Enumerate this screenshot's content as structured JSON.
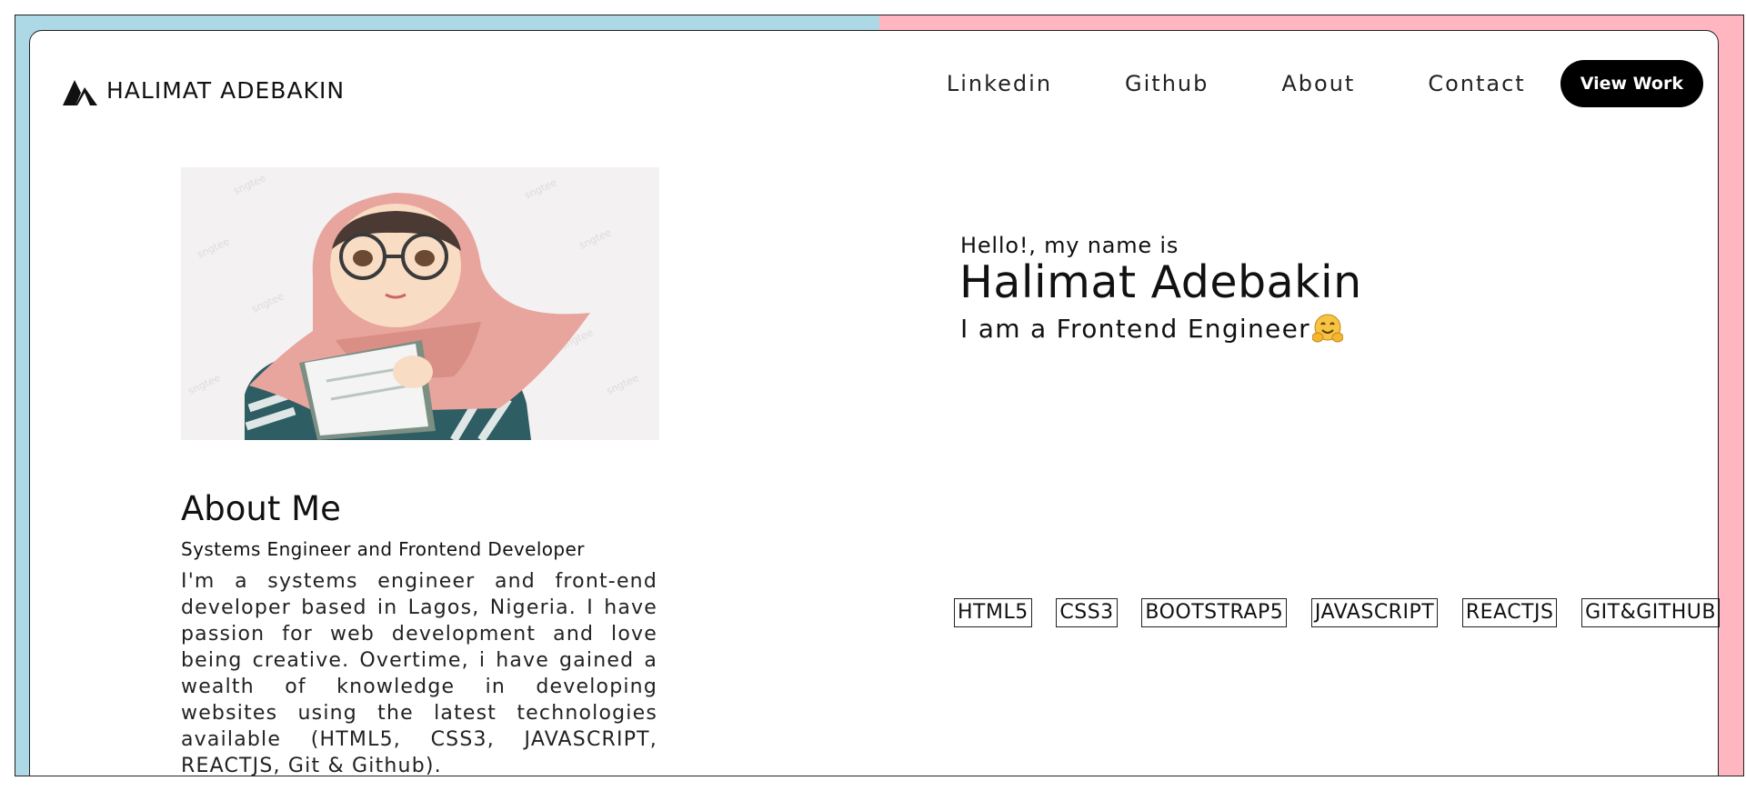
{
  "colors": {
    "left_band": "#ADD8E6",
    "right_band": "#FFB6C1",
    "button_bg": "#000000",
    "button_text": "#FFFFFF"
  },
  "header": {
    "logo_icon": "mountain-logo-icon",
    "logo_text": "HALIMAT ADEBAKIN",
    "nav": [
      {
        "label": "Linkedin"
      },
      {
        "label": "Github"
      },
      {
        "label": "About"
      },
      {
        "label": "Contact"
      }
    ],
    "cta_label": "View Work"
  },
  "hero": {
    "greeting": "Hello!, my name is",
    "name": "Halimat Adebakin",
    "role": "I am a Frontend Engineer",
    "role_emoji": "hugging-face-icon"
  },
  "about": {
    "avatar": "hijab-girl-illustration",
    "title": "About Me",
    "subtitle": "Systems Engineer and Frontend Developer",
    "text": "I'm a systems engineer and front-end developer based in Lagos, Nigeria. I have passion for web development and love being creative. Overtime, i have gained a wealth of knowledge in developing websites using the latest technologies available (HTML5, CSS3, JAVASCRIPT, REACTJS, Git & Github)."
  },
  "skills": [
    "HTML5",
    "CSS3",
    "BOOTSTRAP5",
    "JAVASCRIPT",
    "REACTJS",
    "GIT&GITHUB"
  ]
}
